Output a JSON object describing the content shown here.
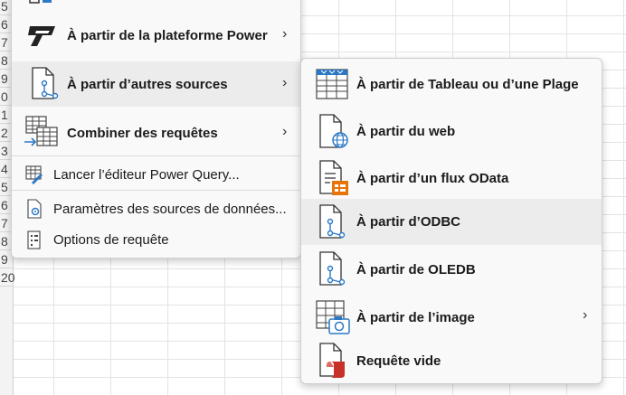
{
  "row_numbers": [
    "5",
    "6",
    "7",
    "8",
    "9",
    "0",
    "1",
    "2",
    "3",
    "4",
    "5",
    "6",
    "7",
    "8",
    "9",
    "20"
  ],
  "main_menu": {
    "items": [
      {
        "label": "À partir de la plateforme Power",
        "icon": "power-platform-icon"
      },
      {
        "label": "À partir d’autres sources",
        "icon": "file-connector-icon"
      },
      {
        "label": "Combiner des requêtes",
        "icon": "combine-tables-icon"
      },
      {
        "label": "Lancer l’éditeur Power Query...",
        "icon": "edit-query-icon"
      },
      {
        "label": "Paramètres des sources de données...",
        "icon": "datasource-settings-icon"
      },
      {
        "label": "Options de requête",
        "icon": "query-options-icon"
      }
    ]
  },
  "sub_menu": {
    "items": [
      {
        "label": "À partir de Tableau ou d’une Plage",
        "icon": "table-range-icon"
      },
      {
        "label": "À partir du web",
        "icon": "web-globe-icon"
      },
      {
        "label": "À partir d’un flux OData",
        "icon": "odata-feed-icon"
      },
      {
        "label": "À partir d’ODBC",
        "icon": "odbc-icon"
      },
      {
        "label": "À partir de OLEDB",
        "icon": "oledb-icon"
      },
      {
        "label": "À partir de l’image",
        "icon": "image-camera-icon"
      },
      {
        "label": "Requête vide",
        "icon": "blank-query-icon"
      }
    ]
  },
  "colors": {
    "highlight": "#ececec",
    "accent_blue": "#2b78c5",
    "accent_orange": "#e8730b",
    "accent_red": "#c8312a"
  }
}
